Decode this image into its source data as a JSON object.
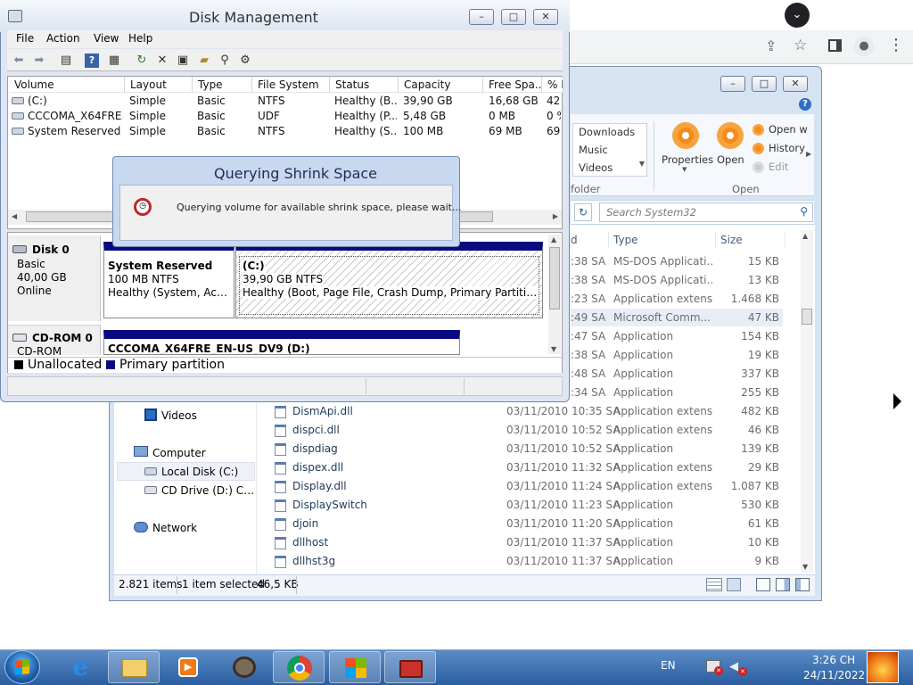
{
  "disk_management": {
    "title": "Disk Management",
    "menu": [
      "File",
      "Action",
      "View",
      "Help"
    ],
    "columns": [
      "Volume",
      "Layout",
      "Type",
      "File System",
      "Status",
      "Capacity",
      "Free Spa...",
      "% F"
    ],
    "volumes": [
      {
        "volume": "(C:)",
        "layout": "Simple",
        "type": "Basic",
        "fs": "NTFS",
        "status": "Healthy (B...",
        "capacity": "39,90 GB",
        "free": "16,68 GB",
        "pct": "42"
      },
      {
        "volume": "CCCOMA_X64FRE...",
        "layout": "Simple",
        "type": "Basic",
        "fs": "UDF",
        "status": "Healthy (P...",
        "capacity": "5,48 GB",
        "free": "0 MB",
        "pct": "0 %"
      },
      {
        "volume": "System Reserved",
        "layout": "Simple",
        "type": "Basic",
        "fs": "NTFS",
        "status": "Healthy (S...",
        "capacity": "100 MB",
        "free": "69 MB",
        "pct": "69"
      }
    ],
    "disk0": {
      "name": "Disk 0",
      "kind": "Basic",
      "size": "40,00 GB",
      "state": "Online"
    },
    "part_sys": {
      "name": "System Reserved",
      "size": "100 MB NTFS",
      "status": "Healthy (System, Active, P"
    },
    "part_c": {
      "name": "(C:)",
      "size": "39,90 GB NTFS",
      "status": "Healthy (Boot, Page File, Crash Dump, Primary Partition)"
    },
    "cdrom": {
      "name": "CD-ROM 0",
      "kind": "CD-ROM",
      "label": "CCCOMA_X64FRE_EN-US_DV9  (D:)"
    },
    "legend": {
      "unallocated": "Unallocated",
      "primary": "Primary partition"
    }
  },
  "dialog": {
    "title": "Querying Shrink Space",
    "message": "Querying volume for available shrink space, please wait..."
  },
  "explorer": {
    "ribbon": {
      "places": [
        "Downloads",
        "Music",
        "Videos"
      ],
      "folder_label": "folder",
      "properties": "Properties",
      "open": "Open",
      "open_with": "Open w",
      "history": "History",
      "edit": "Edit",
      "group_open": "Open"
    },
    "search_placeholder": "Search System32",
    "list_headers": {
      "type": "Type",
      "size": "Size"
    },
    "partial_rows": [
      {
        "time": ":38 SA",
        "type": "MS-DOS Applicati...",
        "size": "15 KB"
      },
      {
        "time": ":38 SA",
        "type": "MS-DOS Applicati...",
        "size": "13 KB"
      },
      {
        "time": ":23 SA",
        "type": "Application extens...",
        "size": "1.468 KB"
      },
      {
        "time": ":49 SA",
        "type": "Microsoft Comm...",
        "size": "47 KB"
      },
      {
        "time": ":47 SA",
        "type": "Application",
        "size": "154 KB"
      },
      {
        "time": ":38 SA",
        "type": "Application",
        "size": "19 KB"
      },
      {
        "time": ":48 SA",
        "type": "Application",
        "size": "337 KB"
      },
      {
        "time": ":34 SA",
        "type": "Application",
        "size": "255 KB"
      }
    ],
    "files": [
      {
        "name": "DismApi.dll",
        "date": "03/11/2010 10:35 SA",
        "type": "Application extens...",
        "size": "482 KB"
      },
      {
        "name": "dispci.dll",
        "date": "03/11/2010 10:52 SA",
        "type": "Application extens...",
        "size": "46 KB"
      },
      {
        "name": "dispdiag",
        "date": "03/11/2010 10:52 SA",
        "type": "Application",
        "size": "139 KB"
      },
      {
        "name": "dispex.dll",
        "date": "03/11/2010 11:32 SA",
        "type": "Application extens...",
        "size": "29 KB"
      },
      {
        "name": "Display.dll",
        "date": "03/11/2010 11:24 SA",
        "type": "Application extens...",
        "size": "1.087 KB"
      },
      {
        "name": "DisplaySwitch",
        "date": "03/11/2010 11:23 SA",
        "type": "Application",
        "size": "530 KB"
      },
      {
        "name": "djoin",
        "date": "03/11/2010 11:20 SA",
        "type": "Application",
        "size": "61 KB"
      },
      {
        "name": "dllhost",
        "date": "03/11/2010 11:37 SA",
        "type": "Application",
        "size": "10 KB"
      },
      {
        "name": "dllhst3g",
        "date": "03/11/2010 11:37 SA",
        "type": "Application",
        "size": "9 KB"
      }
    ],
    "nav": {
      "videos": "Videos",
      "computer": "Computer",
      "local_disk": "Local Disk (C:)",
      "cd_drive": "CD Drive (D:) CCCOI",
      "network": "Network"
    },
    "status": {
      "items": "2.821 items",
      "selected": "1 item selected",
      "size": "46,5 KB"
    }
  },
  "taskbar": {
    "lang": "EN",
    "time": "3:26 CH",
    "date": "24/11/2022"
  },
  "colors": {
    "primary_partition": "#0a0a80",
    "taskbar": "#2a5e9f",
    "dialog_title": "#1a2e55"
  }
}
